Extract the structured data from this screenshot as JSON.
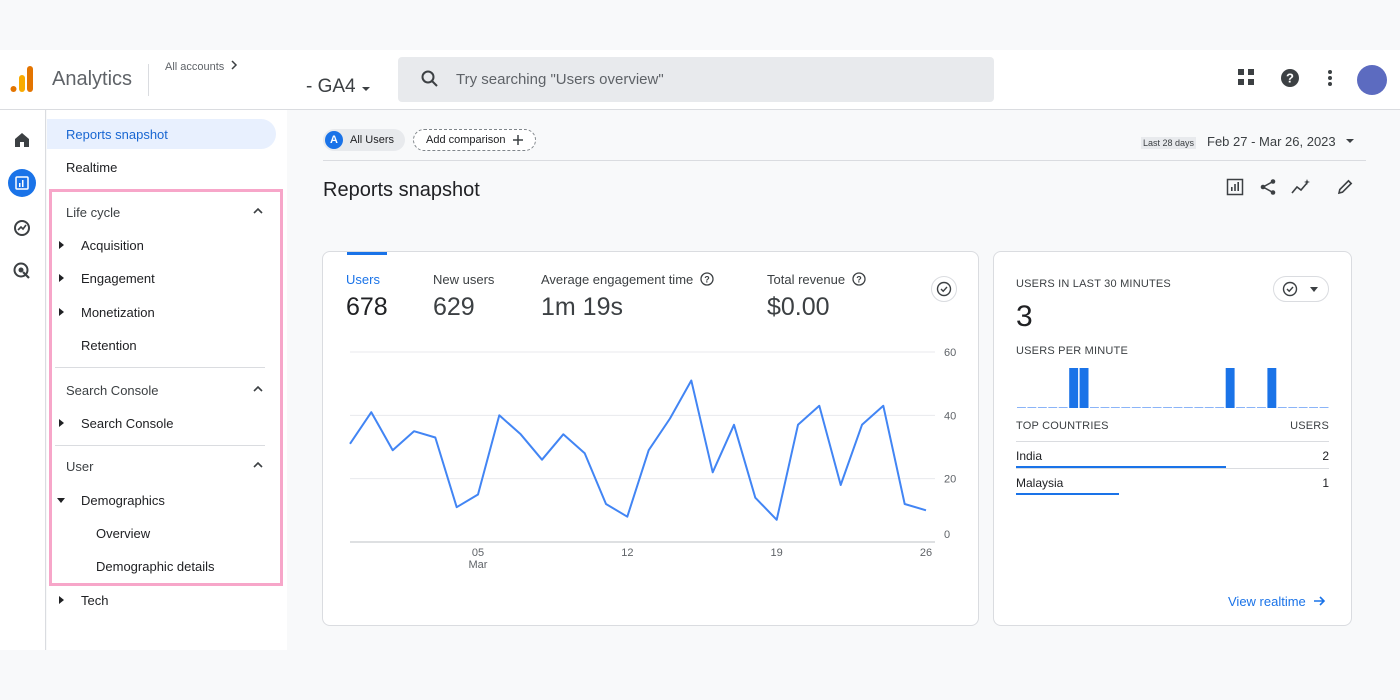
{
  "header": {
    "app_name": "Analytics",
    "accounts_label": "All accounts",
    "property_label": "- GA4",
    "search_placeholder": "Try searching \"Users overview\"",
    "colors": {
      "accent": "#1a73e8",
      "logo_orange": "#f9ab00",
      "logo_dark": "#e37400",
      "avatar": "#5c6bc0"
    }
  },
  "sidebar": {
    "items": [
      {
        "label": "Reports snapshot"
      },
      {
        "label": "Realtime"
      }
    ],
    "sections": [
      {
        "title": "Life cycle",
        "items": [
          "Acquisition",
          "Engagement",
          "Monetization",
          "Retention"
        ]
      },
      {
        "title": "Search Console",
        "items": [
          "Search Console"
        ]
      },
      {
        "title": "User",
        "items": [
          "Demographics",
          "Overview",
          "Demographic details",
          "Tech"
        ]
      }
    ]
  },
  "main": {
    "chip_segment_letter": "A",
    "chip_segment": "All Users",
    "chip_add": "Add comparison",
    "range_period": "Last 28 days",
    "range_dates": "Feb 27 - Mar 26, 2023",
    "title": "Reports snapshot"
  },
  "metrics": [
    {
      "label": "Users",
      "value": "678"
    },
    {
      "label": "New users",
      "value": "629"
    },
    {
      "label": "Average engagement time",
      "value": "1m 19s"
    },
    {
      "label": "Total revenue",
      "value": "$0.00"
    }
  ],
  "chart_data": {
    "type": "line",
    "x": [
      "Feb 27",
      "Feb 28",
      "Mar 1",
      "Mar 2",
      "Mar 3",
      "Mar 4",
      "Mar 5",
      "Mar 6",
      "Mar 7",
      "Mar 8",
      "Mar 9",
      "Mar 10",
      "Mar 11",
      "Mar 12",
      "Mar 13",
      "Mar 14",
      "Mar 15",
      "Mar 16",
      "Mar 17",
      "Mar 18",
      "Mar 19",
      "Mar 20",
      "Mar 21",
      "Mar 22",
      "Mar 23",
      "Mar 24",
      "Mar 25",
      "Mar 26"
    ],
    "series": [
      {
        "values": [
          31,
          41,
          29,
          35,
          33,
          11,
          15,
          40,
          34,
          26,
          34,
          28,
          12,
          8,
          29,
          39,
          51,
          22,
          37,
          14,
          7,
          37,
          43,
          18,
          37,
          43,
          12,
          10
        ]
      }
    ],
    "x_ticks": [
      {
        "x": "Mar 5",
        "label": "05",
        "sublabel": "Mar"
      },
      {
        "x": "Mar 12",
        "label": "12",
        "sublabel": ""
      },
      {
        "x": "Mar 19",
        "label": "19",
        "sublabel": ""
      },
      {
        "x": "Mar 26",
        "label": "26",
        "sublabel": ""
      }
    ],
    "y_ticks": [
      "0",
      "20",
      "40",
      "60"
    ],
    "ylim": [
      0,
      60
    ],
    "grid": true,
    "color": "#4285f4"
  },
  "realtime": {
    "title": "USERS IN LAST 30 MINUTES",
    "count": "3",
    "per_minute_label": "USERS PER MINUTE",
    "per_minute_values": [
      0,
      0,
      0,
      0,
      0,
      1,
      1,
      0,
      0,
      0,
      0,
      0,
      0,
      0,
      0,
      0,
      0,
      0,
      0,
      0,
      1,
      0,
      0,
      0,
      1,
      0,
      0,
      0,
      0,
      0
    ],
    "countries_header": "TOP COUNTRIES",
    "users_header": "USERS",
    "countries": [
      {
        "name": "India",
        "users": "2",
        "share": 0.67
      },
      {
        "name": "Malaysia",
        "users": "1",
        "share": 0.33
      }
    ],
    "view_link": "View realtime"
  }
}
